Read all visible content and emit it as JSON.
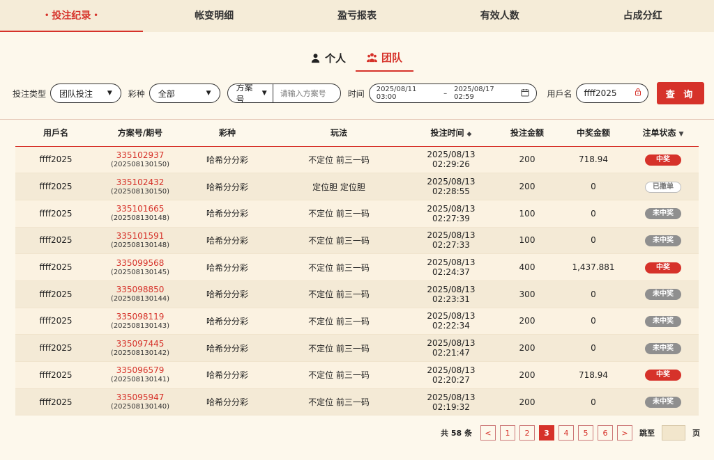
{
  "top_tabs": [
    {
      "label": "投注纪录",
      "active": true
    },
    {
      "label": "帐变明细",
      "active": false
    },
    {
      "label": "盈亏报表",
      "active": false
    },
    {
      "label": "有效人数",
      "active": false
    },
    {
      "label": "占成分红",
      "active": false
    }
  ],
  "segment": {
    "personal": "个人",
    "team": "团队"
  },
  "filters": {
    "bet_type_label": "投注类型",
    "bet_type_value": "团队投注",
    "lottery_label": "彩种",
    "lottery_value": "全部",
    "plan_select": "方案号",
    "plan_placeholder": "请输入方案号",
    "time_label": "时间",
    "date_start": "2025/08/11 03:00",
    "date_sep": "–",
    "date_end": "2025/08/17 02:59",
    "user_label": "用戶名",
    "user_value": "ffff2025",
    "query_button": "查 询"
  },
  "table": {
    "headers": [
      "用戶名",
      "方案号/期号",
      "彩种",
      "玩法",
      "投注时间",
      "投注金额",
      "中奖金额",
      "注单状态"
    ],
    "rows": [
      {
        "user": "ffff2025",
        "plan": "335102937",
        "issue": "(202508130150)",
        "lottery": "哈希分分彩",
        "play": "不定位 前三一码",
        "time": "2025/08/13 02:29:26",
        "bet": "200",
        "win": "718.94",
        "status": "中奖",
        "status_type": "win"
      },
      {
        "user": "ffff2025",
        "plan": "335102432",
        "issue": "(202508130150)",
        "lottery": "哈希分分彩",
        "play": "定位胆 定位胆",
        "time": "2025/08/13 02:28:55",
        "bet": "200",
        "win": "0",
        "status": "已撤单",
        "status_type": "cancel"
      },
      {
        "user": "ffff2025",
        "plan": "335101665",
        "issue": "(202508130148)",
        "lottery": "哈希分分彩",
        "play": "不定位 前三一码",
        "time": "2025/08/13 02:27:39",
        "bet": "100",
        "win": "0",
        "status": "未中奖",
        "status_type": "lose"
      },
      {
        "user": "ffff2025",
        "plan": "335101591",
        "issue": "(202508130148)",
        "lottery": "哈希分分彩",
        "play": "不定位 前三一码",
        "time": "2025/08/13 02:27:33",
        "bet": "100",
        "win": "0",
        "status": "未中奖",
        "status_type": "lose"
      },
      {
        "user": "ffff2025",
        "plan": "335099568",
        "issue": "(202508130145)",
        "lottery": "哈希分分彩",
        "play": "不定位 前三一码",
        "time": "2025/08/13 02:24:37",
        "bet": "400",
        "win": "1,437.881",
        "status": "中奖",
        "status_type": "win"
      },
      {
        "user": "ffff2025",
        "plan": "335098850",
        "issue": "(202508130144)",
        "lottery": "哈希分分彩",
        "play": "不定位 前三一码",
        "time": "2025/08/13 02:23:31",
        "bet": "300",
        "win": "0",
        "status": "未中奖",
        "status_type": "lose"
      },
      {
        "user": "ffff2025",
        "plan": "335098119",
        "issue": "(202508130143)",
        "lottery": "哈希分分彩",
        "play": "不定位 前三一码",
        "time": "2025/08/13 02:22:34",
        "bet": "200",
        "win": "0",
        "status": "未中奖",
        "status_type": "lose"
      },
      {
        "user": "ffff2025",
        "plan": "335097445",
        "issue": "(202508130142)",
        "lottery": "哈希分分彩",
        "play": "不定位 前三一码",
        "time": "2025/08/13 02:21:47",
        "bet": "200",
        "win": "0",
        "status": "未中奖",
        "status_type": "lose"
      },
      {
        "user": "ffff2025",
        "plan": "335096579",
        "issue": "(202508130141)",
        "lottery": "哈希分分彩",
        "play": "不定位 前三一码",
        "time": "2025/08/13 02:20:27",
        "bet": "200",
        "win": "718.94",
        "status": "中奖",
        "status_type": "win"
      },
      {
        "user": "ffff2025",
        "plan": "335095947",
        "issue": "(202508130140)",
        "lottery": "哈希分分彩",
        "play": "不定位 前三一码",
        "time": "2025/08/13 02:19:32",
        "bet": "200",
        "win": "0",
        "status": "未中奖",
        "status_type": "lose"
      }
    ]
  },
  "pagination": {
    "total": "共 58 条",
    "prev": "<",
    "next": ">",
    "pages": [
      "1",
      "2",
      "3",
      "4",
      "5",
      "6"
    ],
    "current": "3",
    "jump_label": "跳至",
    "page_suffix": "页"
  },
  "colors": {
    "accent": "#d6322a",
    "background": "#fdf8ec",
    "lose_badge": "#8f8f8f"
  },
  "icons": {
    "personal": "user-icon",
    "team": "team-icon",
    "calendar": "calendar-icon",
    "clear": "clear-icon",
    "sort": "sort-icon",
    "filter": "filter-icon"
  }
}
